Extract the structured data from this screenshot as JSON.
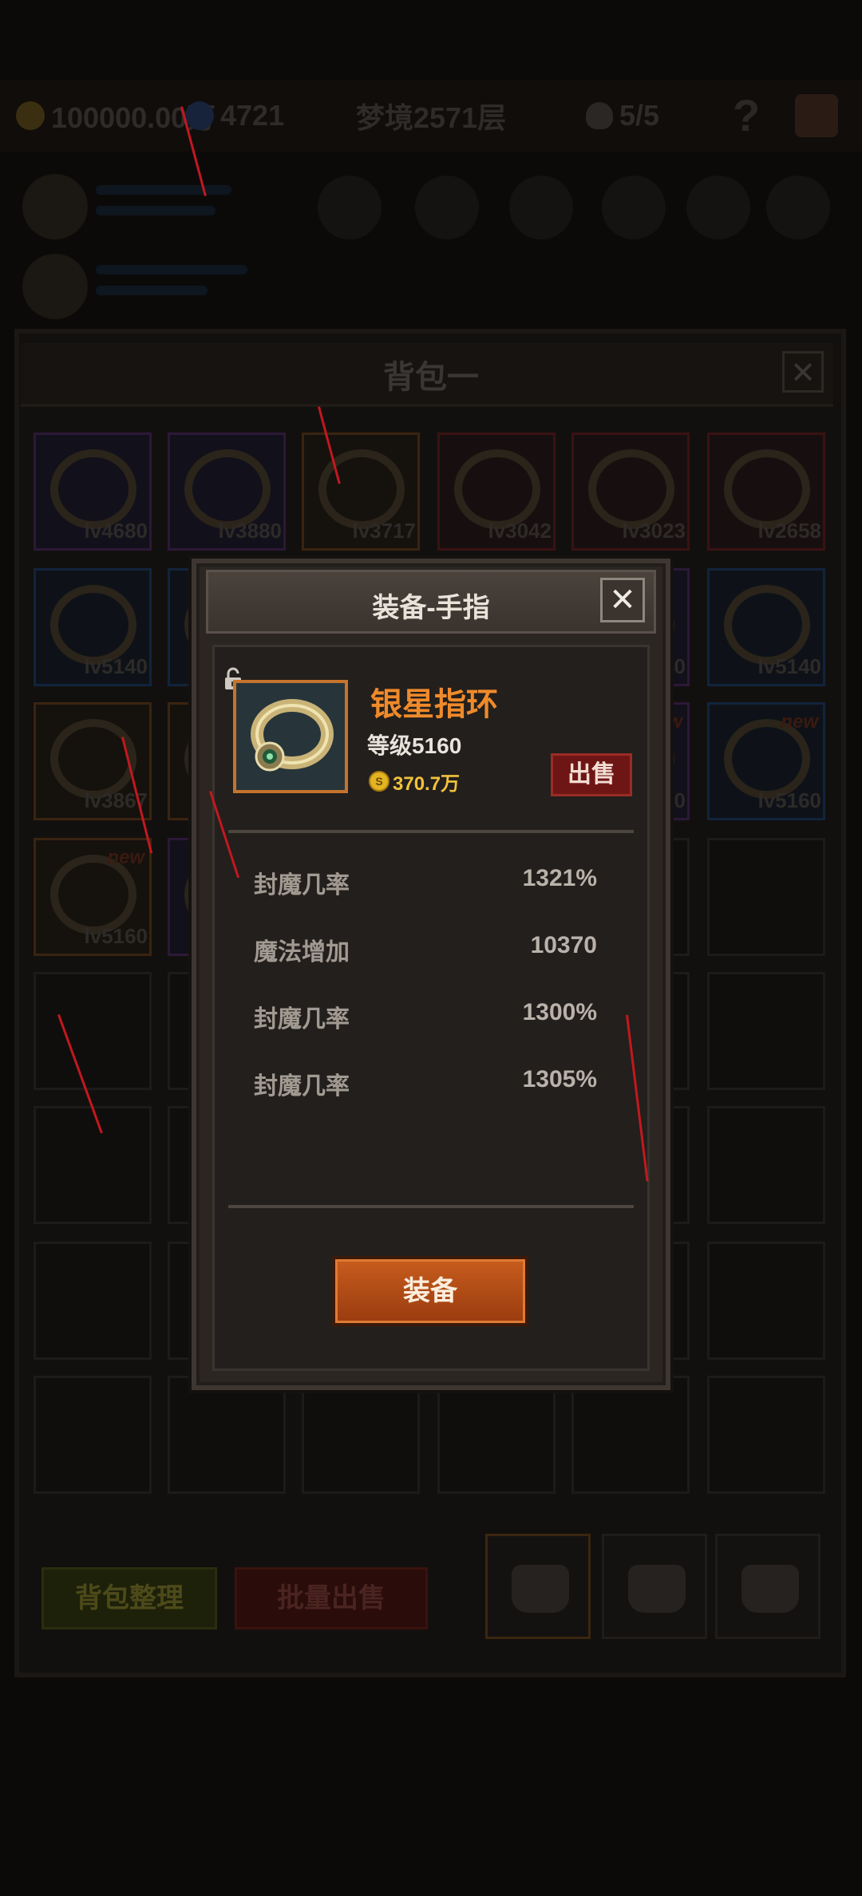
{
  "top_bar": {
    "gold": "100000.00万",
    "gems": "4721",
    "dream_floor": "梦境2571层",
    "skull_count": "5/5",
    "help": "?"
  },
  "backpack": {
    "title": "背包一",
    "close": "✕",
    "slots": [
      {
        "lv": "lv4680",
        "rarity": "purple",
        "new": ""
      },
      {
        "lv": "lv3880",
        "rarity": "purple",
        "new": ""
      },
      {
        "lv": "lv3717",
        "rarity": "orange",
        "new": ""
      },
      {
        "lv": "lv3042",
        "rarity": "red",
        "new": ""
      },
      {
        "lv": "lv3023",
        "rarity": "red",
        "new": ""
      },
      {
        "lv": "lv2658",
        "rarity": "red",
        "new": ""
      },
      {
        "lv": "lv5140",
        "rarity": "blue",
        "new": ""
      },
      {
        "lv": "",
        "rarity": "blue",
        "new": ""
      },
      {
        "lv": "",
        "rarity": "purple",
        "new": ""
      },
      {
        "lv": "",
        "rarity": "purple",
        "new": ""
      },
      {
        "lv": "40",
        "rarity": "purple",
        "new": ""
      },
      {
        "lv": "lv5140",
        "rarity": "blue",
        "new": ""
      },
      {
        "lv": "lv3867",
        "rarity": "orange",
        "new": ""
      },
      {
        "lv": "",
        "rarity": "orange",
        "new": ""
      },
      {
        "lv": "",
        "rarity": "purple",
        "new": ""
      },
      {
        "lv": "",
        "rarity": "purple",
        "new": ""
      },
      {
        "lv": "60",
        "rarity": "purple",
        "new": "new"
      },
      {
        "lv": "lv5160",
        "rarity": "blue",
        "new": "new"
      },
      {
        "lv": "lv5160",
        "rarity": "orange",
        "new": "new"
      },
      {
        "lv": "",
        "rarity": "purple",
        "new": ""
      }
    ],
    "sort_button": "背包整理",
    "bulk_sell_button": "批量出售"
  },
  "dialog": {
    "title": "装备-手指",
    "close": "✕",
    "item_name": "银星指环",
    "level": "等级5160",
    "price_coin": "S",
    "price": "370.7万",
    "sell_button": "出售",
    "stats": [
      {
        "name": "封魔几率",
        "value": "1321%"
      },
      {
        "name": "魔法增加",
        "value": "10370"
      },
      {
        "name": "封魔几率",
        "value": "1300%"
      },
      {
        "name": "封魔几率",
        "value": "1305%"
      }
    ],
    "equip_button": "装备"
  },
  "colors": {
    "item_name": "#ef8a2b",
    "price": "#f0c23c",
    "equip_button": "#c65b1d",
    "sell_button": "#6e1616",
    "rarity_frame": "#c5742d"
  }
}
